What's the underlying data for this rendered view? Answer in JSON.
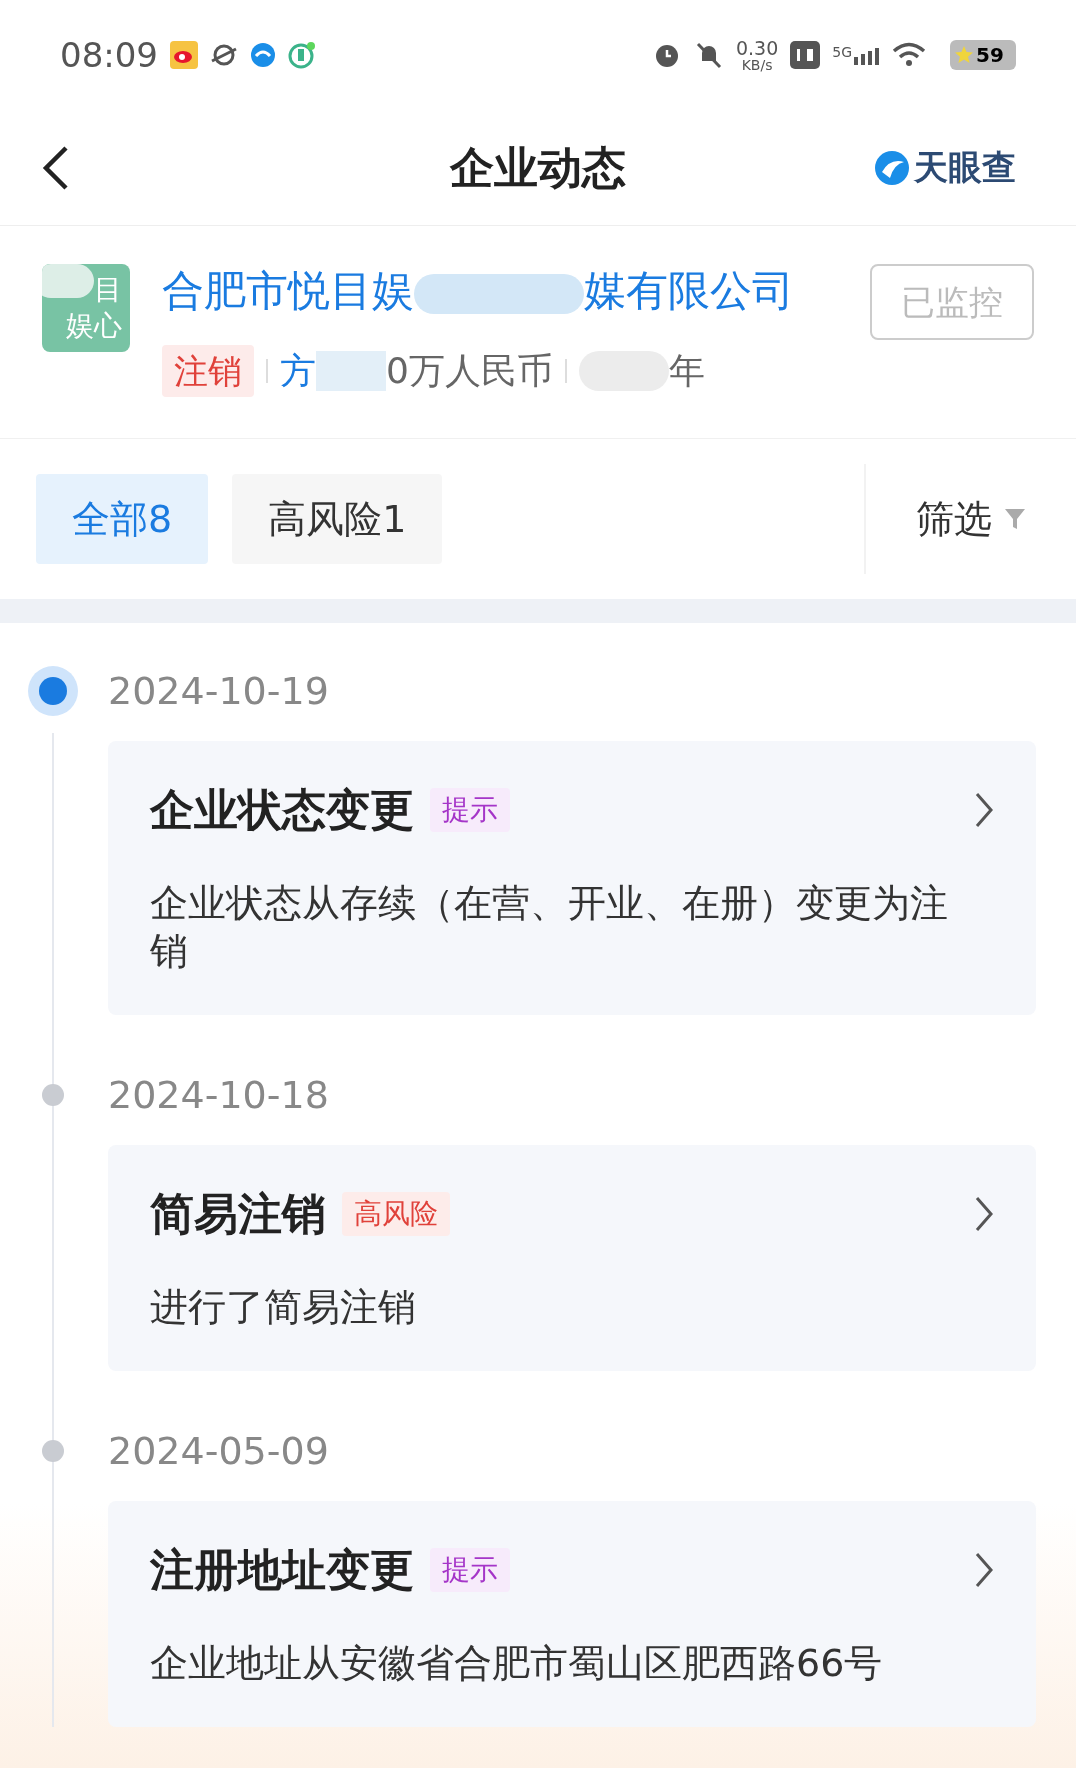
{
  "status_bar": {
    "time": "08:09",
    "net_speed": "0.30",
    "net_unit": "KB/s",
    "network": "5G",
    "battery": "59"
  },
  "header": {
    "title": "企业动态",
    "brand": "天眼查"
  },
  "company": {
    "logo_lines": [
      "目",
      "娱心"
    ],
    "name_start": "合肥市悦目娱",
    "name_end": "媒有限公司",
    "status": "注销",
    "capital_start": "方",
    "capital_end": "0万人民币",
    "age_end": "年",
    "monitor_button": "已监控"
  },
  "filters": [
    {
      "label": "全部8",
      "selected": true
    },
    {
      "label": "高风险1",
      "selected": false
    }
  ],
  "filter_button": "筛选",
  "events": [
    {
      "date": "2024-10-19",
      "active": true,
      "title": "企业状态变更",
      "tag": "提示",
      "kind": "hint",
      "detail": "企业状态从存续（在营、开业、在册）变更为注销"
    },
    {
      "date": "2024-10-18",
      "active": false,
      "title": "简易注销",
      "tag": "高风险",
      "kind": "risk",
      "detail": "进行了简易注销"
    },
    {
      "date": "2024-05-09",
      "active": false,
      "title": "注册地址变更",
      "tag": "提示",
      "kind": "hint",
      "detail": "企业地址从安徽省合肥市蜀山区肥西路66号"
    }
  ]
}
